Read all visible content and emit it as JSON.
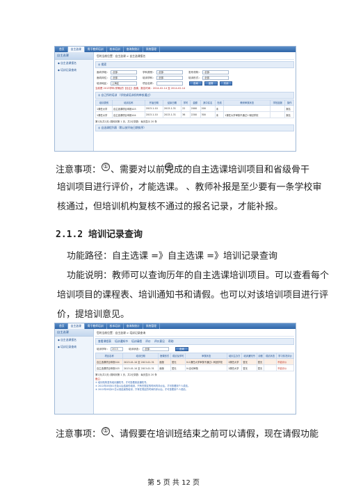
{
  "shot1": {
    "nav_tabs": [
      "首页",
      "自主选课",
      "骨干教师培训",
      "校本培训",
      "查询和统计",
      "系统管理"
    ],
    "sidebar_header": "自主选课",
    "sidebar_items": [
      "◆ 自主选课报名",
      "◆ 培训记录查询"
    ],
    "breadcrumb": "您的当前位置：自主选课 > 自主选课报名",
    "search_bar": "◎ 搜索",
    "form": {
      "l1": "面向学段：",
      "v1": "-全部-",
      "l2": "学科类别：",
      "v2": "-全部-",
      "l3": "发布机构：",
      "v3": "-全部-",
      "l4": "面向岗位：",
      "v4": "-全部-",
      "l5": "培训学科：",
      "v5": "-全部-",
      "l6": "培训形式：",
      "v6": "-全部-",
      "l7": "培训地区：",
      "v7": "上海区",
      "l8": "项目名称：",
      "v8": "",
      "btn_search": "查询",
      "btn_reset": "重置",
      "btn_close": "关闭"
    },
    "notice": "当前是 2013学年(学期)的【自主】选课，报名时间：2014-02-14 至 2014-02-14",
    "list_bar": "◎ 自己所的培训 （学校或培训机构审核通过）",
    "table_headers": [
      "培训类别",
      "培训名称",
      "开始日期",
      "结束日期",
      "学时",
      "金额",
      "其中实名",
      "在线",
      "教研审核状态",
      "学校选报",
      "操作"
    ],
    "rows": [
      {
        "cat": "1课任大学",
        "name": "自主选课项目申报103",
        "start": "2013-1-10",
        "end": "2013-1-31",
        "hours": "22",
        "fee": "2000",
        "real": "200",
        "online": "未",
        "status": "",
        "school": "",
        "op": "报名"
      },
      {
        "cat": "1课任大学",
        "name": "自主选课项目申报104",
        "start": "2013-1-10",
        "end": "2013-1-31",
        "hours": "36",
        "fee": "2200",
        "real": "300",
        "online": "未",
        "status": "1课任大学审核不通过1 转回学校",
        "school": "",
        "op": "报名"
      }
    ],
    "pager": "第1页(共1页) 跳转到第 1 页，共2记录数：每页显示 20 条",
    "bar3": "◎ 自选课程列表（默认按开始日期排序）"
  },
  "para1": {
    "a": "注意事项：",
    "b": "、需要对以前完成的自主选课培训项目和省级骨干",
    "c": "培训项目进行评价，才能选课。",
    "d": "、教师补报是至少要有一条学校审",
    "e": "核通过，但培训机构复核不通过的报名记录，才能补报。"
  },
  "circled": [
    "①",
    "②",
    "①"
  ],
  "heading": "2.1.2 培训记录查询",
  "para2": {
    "a": "功能路径：自主选课 =》自主选课 =》培训记录查询",
    "b": "功能说明：教师可以查询历年的自主选课培训项目。可以查看每个",
    "c": "培训项目的课程表、培训通知书和请假。也可以对该培训项目进行评",
    "d": "价，提培训意见。"
  },
  "shot2": {
    "nav_tabs": [
      "首页",
      "自主选课",
      "骨干教师培训",
      "校本培训",
      "查询和统计",
      "系统管理"
    ],
    "sidebar_header": "自主选课",
    "sidebar_items": [
      "◆ 自主选课报名",
      "◆ 培训记录查询"
    ],
    "breadcrumb": "您的当前位置：自主选课 > 培训记录查询",
    "toolbar": [
      "查看课程表",
      "培训通知书",
      "培训请假",
      "评价",
      "评价意见",
      "帮助"
    ],
    "filter": {
      "l1": "培训学年：",
      "v1": "2013",
      "l2": "培训状态：",
      "v2": "-全部-",
      "btn": "查询"
    },
    "table_headers": [
      "项目名称",
      "培训日期",
      "授课形式",
      "成绩及学时",
      "审核状态",
      "培训主办方",
      "培训通知书",
      "请假",
      "成绩状态",
      "学习情况评价"
    ],
    "rows": [
      {
        "name": "自主选课项目申报104",
        "date": "2013-01-10 至 2013-01-31",
        "mode": "面授",
        "score": "暂无",
        "status": "N.1课任大学审核不通过1 转回学校",
        "org": "1课任大学",
        "notice": "暂无",
        "leave": "暂无",
        "state": "",
        "eval": "不能评价"
      },
      {
        "name": "自主选课项目申报103",
        "date": "2013-01-10 至 2013-01-31",
        "mode": "面授",
        "score": "暂无",
        "status": "N.自动审核",
        "org": "1课任大学",
        "notice": "暂无",
        "leave": "暂无",
        "state": "",
        "eval": "不能评价"
      }
    ],
    "pager": "第1页(共1页) 跳转到第 1 页，共2记录数：每页显示 20 条",
    "notes_title": "备注：",
    "notes": [
      "① 培训机构发布培训通知书，才可查看到该通知书。",
      "② 2012年05月01日及以后结束的培训，只有在规定的时间内评价后，才可查看到个人成绩。",
      "③ 2012年05月01日以前结束的培训，只有在规定的时间内评价后，才可查看到个人成绩。"
    ]
  },
  "para3": {
    "a": "注意事项：",
    "b": "、请假要在培训班结束之前可以请假，现在请假功能"
  },
  "footer": "第 5 页 共 12 页"
}
